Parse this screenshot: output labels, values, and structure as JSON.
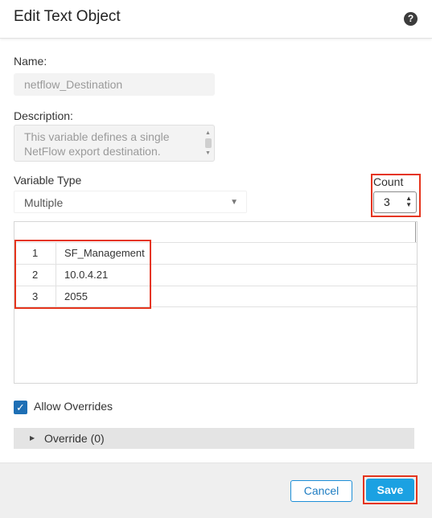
{
  "dialog": {
    "title": "Edit Text Object",
    "help_icon": "?"
  },
  "name": {
    "label": "Name:",
    "value": "netflow_Destination"
  },
  "description": {
    "label": "Description:",
    "line1": "This variable defines a single",
    "line2": "NetFlow export destination."
  },
  "variable_type": {
    "label": "Variable Type",
    "selected": "Multiple",
    "caret_icon": "▼"
  },
  "count": {
    "label": "Count",
    "value": "3",
    "arrows": "▲▼"
  },
  "table": {
    "rows": [
      {
        "index": "1",
        "value": "SF_Management"
      },
      {
        "index": "2",
        "value": "10.0.4.21"
      },
      {
        "index": "3",
        "value": "2055"
      }
    ]
  },
  "allow_overrides": {
    "label": "Allow Overrides",
    "checked": true,
    "check_glyph": "✓"
  },
  "override": {
    "label": "Override (0)",
    "expand_icon": "▶"
  },
  "footer": {
    "cancel_label": "Cancel",
    "save_label": "Save"
  },
  "colors": {
    "highlight": "#e5341c",
    "primary": "#1ba1e2",
    "checkbox": "#1e6fb5"
  }
}
